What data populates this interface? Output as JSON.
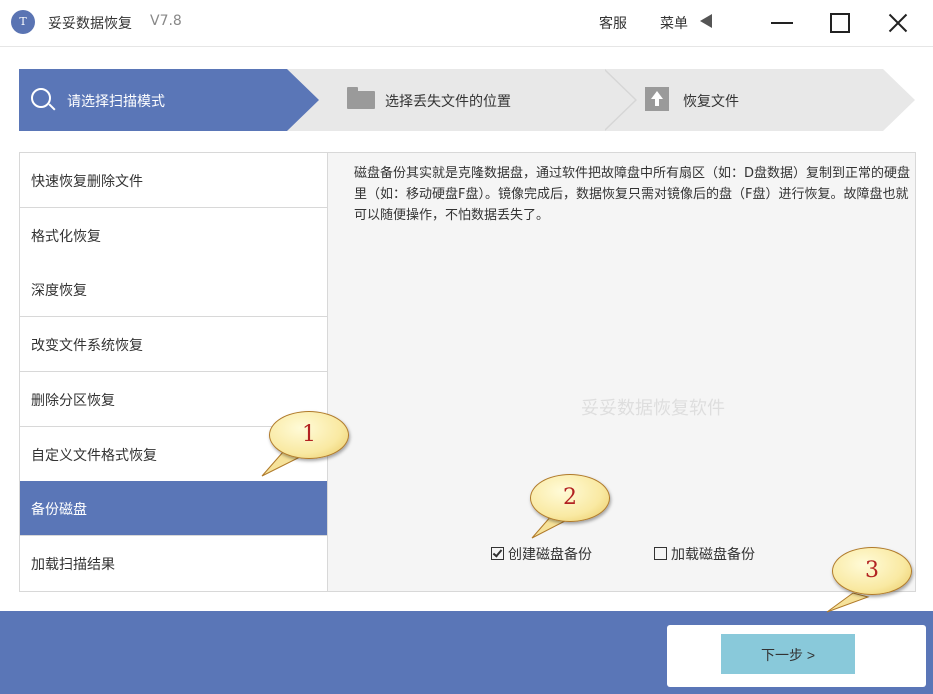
{
  "titlebar": {
    "app_title": "妥妥数据恢复",
    "version": "V7.8",
    "support": "客服",
    "menu": "菜单"
  },
  "steps": [
    {
      "label": "请选择扫描模式",
      "icon": "search-icon",
      "active": true
    },
    {
      "label": "选择丢失文件的位置",
      "icon": "folder-icon",
      "active": false
    },
    {
      "label": "恢复文件",
      "icon": "restore-icon",
      "active": false
    }
  ],
  "modes": [
    {
      "label": "快速恢复删除文件"
    },
    {
      "label": "格式化恢复"
    },
    {
      "label": "深度恢复"
    },
    {
      "label": "改变文件系统恢复"
    },
    {
      "label": "删除分区恢复"
    },
    {
      "label": "自定义文件格式恢复"
    },
    {
      "label": "备份磁盘",
      "selected": true
    },
    {
      "label": "加载扫描结果"
    }
  ],
  "panel": {
    "description": "磁盘备份其实就是克隆数据盘，通过软件把故障盘中所有扇区（如：D盘数据）复制到正常的硬盘里（如：移动硬盘F盘）。镜像完成后，数据恢复只需对镜像后的盘（F盘）进行恢复。故障盘也就可以随便操作，不怕数据丢失了。",
    "watermark": "妥妥数据恢复软件",
    "create_backup": {
      "label": "创建磁盘备份",
      "checked": true
    },
    "load_backup": {
      "label": "加载磁盘备份",
      "checked": false
    }
  },
  "footer": {
    "next_label": "下一步 >"
  },
  "callouts": [
    "1",
    "2",
    "3"
  ],
  "colors": {
    "accent": "#5a76b7",
    "next_button": "#89c9da",
    "callout_text": "#b22222"
  }
}
